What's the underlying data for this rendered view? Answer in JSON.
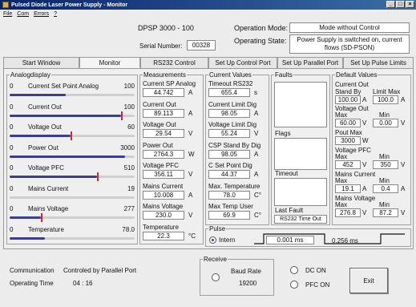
{
  "window": {
    "title": "Pulsed Diode Laser Power Supply - Monitor",
    "buttons": [
      "_",
      "□",
      "×"
    ]
  },
  "menu": [
    "File",
    "Com",
    "Errors",
    "?"
  ],
  "header": {
    "device": "DPSP  3000 - 100",
    "serial_label": "Serial Number:",
    "serial_value": "00328",
    "op_mode_label": "Operation Mode:",
    "op_mode_value": "Mode without Control",
    "op_state_label": "Operating State:",
    "op_state_value": "Power Supply is switched on,          current flows (SD-PSON)"
  },
  "tabs": [
    "Start Window",
    "Monitor",
    "RS232 Control",
    "Set Up Control Port",
    "Set Up Parallel Port",
    "Set Up Pulse Limits"
  ],
  "analog": {
    "title": "Analogdisplay",
    "rows": [
      {
        "min": "0",
        "label": "Current Set Point Analog",
        "max": "100",
        "fraction": 0.45,
        "marker": null
      },
      {
        "min": "0",
        "label": "Current Out",
        "max": "100",
        "fraction": 0.89,
        "marker": 0.89
      },
      {
        "min": "0",
        "label": "Voltage Out",
        "max": "60",
        "fraction": 0.49,
        "marker": 0.49
      },
      {
        "min": "0",
        "label": "Power Out",
        "max": "3000",
        "fraction": 0.92,
        "marker": null
      },
      {
        "min": "0",
        "label": "Voltage PFC",
        "max": "510",
        "fraction": 0.7,
        "marker": 0.7
      },
      {
        "min": "0",
        "label": "Mains Current",
        "max": "19",
        "fraction": 0,
        "marker": null
      },
      {
        "min": "0",
        "label": "Mains Voltage",
        "max": "277",
        "fraction": 0.25,
        "marker": 0.25
      },
      {
        "min": "0",
        "label": "Temperature",
        "max": "78.0",
        "fraction": 0.28,
        "marker": null
      }
    ]
  },
  "measurements": {
    "title": "Measurements",
    "items": [
      {
        "label": "Current SP Analog",
        "value": "44.742",
        "unit": "A"
      },
      {
        "label": "Current Out",
        "value": "89.113",
        "unit": "A"
      },
      {
        "label": "Voltage Out",
        "value": "29.54",
        "unit": "V"
      },
      {
        "label": "Power Out",
        "value": "2764.3",
        "unit": "W"
      },
      {
        "label": "Voltage PFC",
        "value": "356.11",
        "unit": "V"
      },
      {
        "label": "Mains Current",
        "value": "10.008",
        "unit": "A"
      },
      {
        "label": "Mains Voltage",
        "value": "230.0",
        "unit": "V"
      },
      {
        "label": "Temperature",
        "value": "22.3",
        "unit": "°C"
      }
    ]
  },
  "current_values": {
    "title": "Current Values",
    "items": [
      {
        "label": "Timeout RS232",
        "value": "655.4",
        "unit": "s"
      },
      {
        "label": "Current Limit Dig",
        "value": "98.05",
        "unit": "A"
      },
      {
        "label": "Voltage Limit Dig",
        "value": "55.24",
        "unit": "V"
      },
      {
        "label": "CSP Stand By Dig",
        "value": "98.05",
        "unit": "A"
      },
      {
        "label": "C Set Point Dig",
        "value": "44.37",
        "unit": "A"
      },
      {
        "label": "Max. Temperature",
        "value": "78.0",
        "unit": "C°"
      },
      {
        "label": "Max Temp User",
        "value": "69.9",
        "unit": "C°"
      }
    ]
  },
  "faults": {
    "title": "Faults",
    "flags": "Flags",
    "timeout": "Timeout",
    "last_fault_label": "Last Fault",
    "last_fault_value": "RS232 Time Out"
  },
  "defaults": {
    "title": "Default Values",
    "current_out": "Current Out",
    "standby_label": "Stand By",
    "limit_max_label": "Limit Max",
    "standby_value": "100.00",
    "limit_max_value": "100.0",
    "amp": "A",
    "voltage_out": "Voltage Out",
    "max": "Max",
    "min": "Min",
    "vout_max": "60.00",
    "vout_min": "0.00",
    "volt": "V",
    "pout_max_label": "Pout Max",
    "pout_max": "3000",
    "watt": "W",
    "vpfc_label": "Voltage PFC",
    "vpfc_max": "452",
    "vpfc_min": "350",
    "mains_current_label": "Mains Current",
    "mc_max": "19.1",
    "mc_min": "0.4",
    "mains_voltage_label": "Mains Voltage",
    "mv_max": "276.8",
    "mv_min": "87.2"
  },
  "pulse": {
    "title": "Pulse",
    "mode": "Intern",
    "t_high": "0.001 ms",
    "t_low": "0.256 ms"
  },
  "footer": {
    "comm_label": "Communication",
    "comm_value": "Controled by Parallel Port",
    "optime_label": "Operating Time",
    "optime_value": "04 : 16",
    "receive_title": "Receive",
    "baud_label": "Baud Rate",
    "baud_value": "19200",
    "dc_on": "DC ON",
    "pfc_on": "PFC ON",
    "exit": "Exit"
  }
}
